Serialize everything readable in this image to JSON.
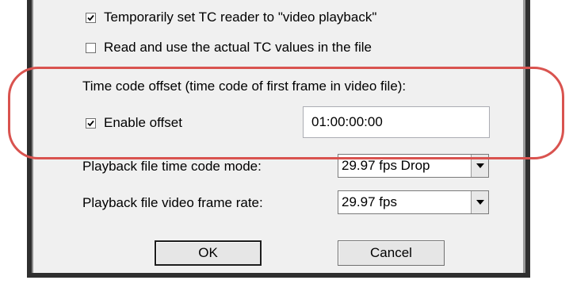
{
  "checkboxes": {
    "temp_tc_reader": {
      "label": "Temporarily set TC reader to \"video playback\"",
      "checked": true
    },
    "read_actual_tc": {
      "label": "Read and use the actual TC values in the file",
      "checked": false
    },
    "enable_offset": {
      "label": "Enable offset",
      "checked": true
    }
  },
  "offset_section": {
    "heading": "Time code offset (time code of first frame in video file):",
    "offset_value": "01:00:00:00"
  },
  "playback_mode": {
    "label": "Playback file time code mode:",
    "selected": "29.97 fps Drop"
  },
  "frame_rate": {
    "label": "Playback file video frame rate:",
    "selected": "29.97 fps"
  },
  "buttons": {
    "ok": "OK",
    "cancel": "Cancel"
  },
  "colors": {
    "highlight": "#d9534f",
    "dialog_bg": "#f0f0f0"
  }
}
